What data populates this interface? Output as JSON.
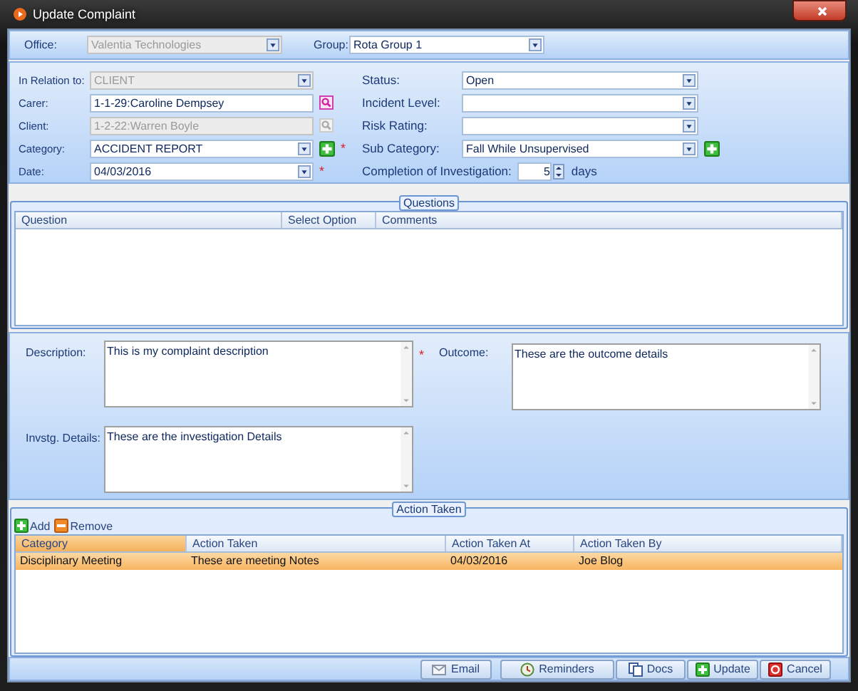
{
  "window": {
    "title": "Update Complaint"
  },
  "header_fields": [
    {
      "label": "Office:",
      "value": "Valentia Technologies",
      "disabled": true
    },
    {
      "label": "Group:",
      "value": "Rota Group 1",
      "disabled": false
    }
  ],
  "left_fields": [
    {
      "label": "In Relation to:",
      "kind": "select",
      "value": "CLIENT",
      "disabled": true
    },
    {
      "label": "Carer:",
      "kind": "lookup",
      "value": "1-1-29:Caroline Dempsey",
      "disabled": false
    },
    {
      "label": "Client:",
      "kind": "lookup",
      "value": "1-2-22:Warren Boyle",
      "disabled": true
    },
    {
      "label": "Category:",
      "kind": "select",
      "value": "ACCIDENT REPORT",
      "disabled": false,
      "add_button": true,
      "required_mark": "*"
    },
    {
      "label": "Date:",
      "kind": "select",
      "value": "04/03/2016",
      "disabled": false,
      "required_mark": "*"
    }
  ],
  "right_fields": [
    {
      "label": "Status:",
      "kind": "select",
      "value": "Open",
      "disabled": false
    },
    {
      "label": "Incident Level:",
      "kind": "select",
      "disabled": false
    },
    {
      "label": "Risk Rating:",
      "kind": "select",
      "disabled": false
    },
    {
      "label": "Sub Category:",
      "kind": "select",
      "value": "Fall While Unsupervised",
      "disabled": false,
      "add_button": true
    },
    {
      "label": "Completion of Investigation:",
      "kind": "spinner",
      "value": "5",
      "suffix": "days"
    }
  ],
  "questions": {
    "title": "Questions",
    "columns": [
      "Question",
      "Select Option",
      "Comments"
    ]
  },
  "notes": [
    {
      "label": "Description:",
      "value": "This is my complaint description",
      "required_mark": "*"
    },
    {
      "label": "Outcome:",
      "value": "These are the outcome details"
    },
    {
      "label": "Invstg. Details:",
      "value": "These are the investigation Details"
    }
  ],
  "action_taken": {
    "title": "Action Taken",
    "toolbar": [
      {
        "kind": "add",
        "label": "Add"
      },
      {
        "kind": "remove",
        "label": "Remove"
      }
    ],
    "columns": [
      "Category",
      "Action Taken",
      "Action Taken At",
      "Action Taken By"
    ],
    "rows": [
      {
        "cells": [
          "Disciplinary Meeting",
          "These are meeting Notes",
          "04/03/2016",
          "Joe Blog"
        ],
        "selected": true
      }
    ]
  },
  "buttons": [
    {
      "kind": "email",
      "label": "Email"
    },
    {
      "kind": "reminders",
      "label": "Reminders"
    },
    {
      "kind": "docs",
      "label": "Docs"
    },
    {
      "kind": "update",
      "label": "Update"
    },
    {
      "kind": "cancel",
      "label": "Cancel"
    }
  ]
}
